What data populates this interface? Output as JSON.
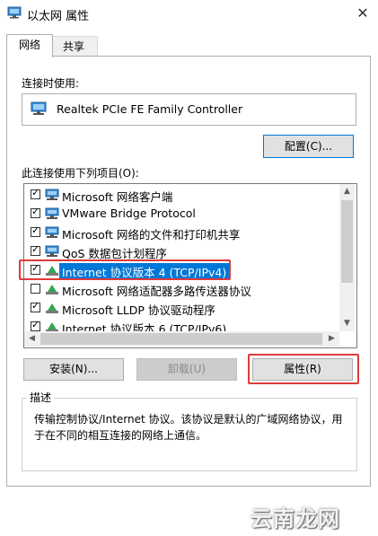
{
  "window": {
    "title": "以太网 属性",
    "close_glyph": "✕"
  },
  "tabs": [
    {
      "label": "网络",
      "active": true
    },
    {
      "label": "共享",
      "active": false
    }
  ],
  "connect_using_label": "连接时使用:",
  "adapter_name": "Realtek PCIe FE Family Controller",
  "configure_button": "配置(C)...",
  "items_label": "此连接使用下列项目(O):",
  "items": [
    {
      "label": "Microsoft 网络客户端",
      "checked": true,
      "icon": "network-client-icon"
    },
    {
      "label": "VMware Bridge Protocol",
      "checked": true,
      "icon": "network-service-icon"
    },
    {
      "label": "Microsoft 网络的文件和打印机共享",
      "checked": true,
      "icon": "network-service-icon"
    },
    {
      "label": "QoS 数据包计划程序",
      "checked": true,
      "icon": "network-service-icon"
    },
    {
      "label": "Internet 协议版本 4 (TCP/IPv4)",
      "checked": true,
      "selected": true,
      "icon": "protocol-icon"
    },
    {
      "label": "Microsoft 网络适配器多路传送器协议",
      "checked": false,
      "icon": "protocol-icon"
    },
    {
      "label": "Microsoft LLDP 协议驱动程序",
      "checked": true,
      "icon": "protocol-icon"
    },
    {
      "label": "Internet 协议版本 6 (TCP/IPv6)",
      "checked": true,
      "icon": "protocol-icon"
    }
  ],
  "buttons": {
    "install": "安装(N)...",
    "uninstall": "卸载(U)",
    "properties": "属性(R)"
  },
  "description": {
    "title": "描述",
    "text": "传输控制协议/Internet 协议。该协议是默认的广域网络协议，用于在不同的相互连接的网络上通信。"
  },
  "watermark": "云南龙网",
  "colors": {
    "accent": "#0078d7",
    "highlight_frame": "#e03a3a"
  }
}
